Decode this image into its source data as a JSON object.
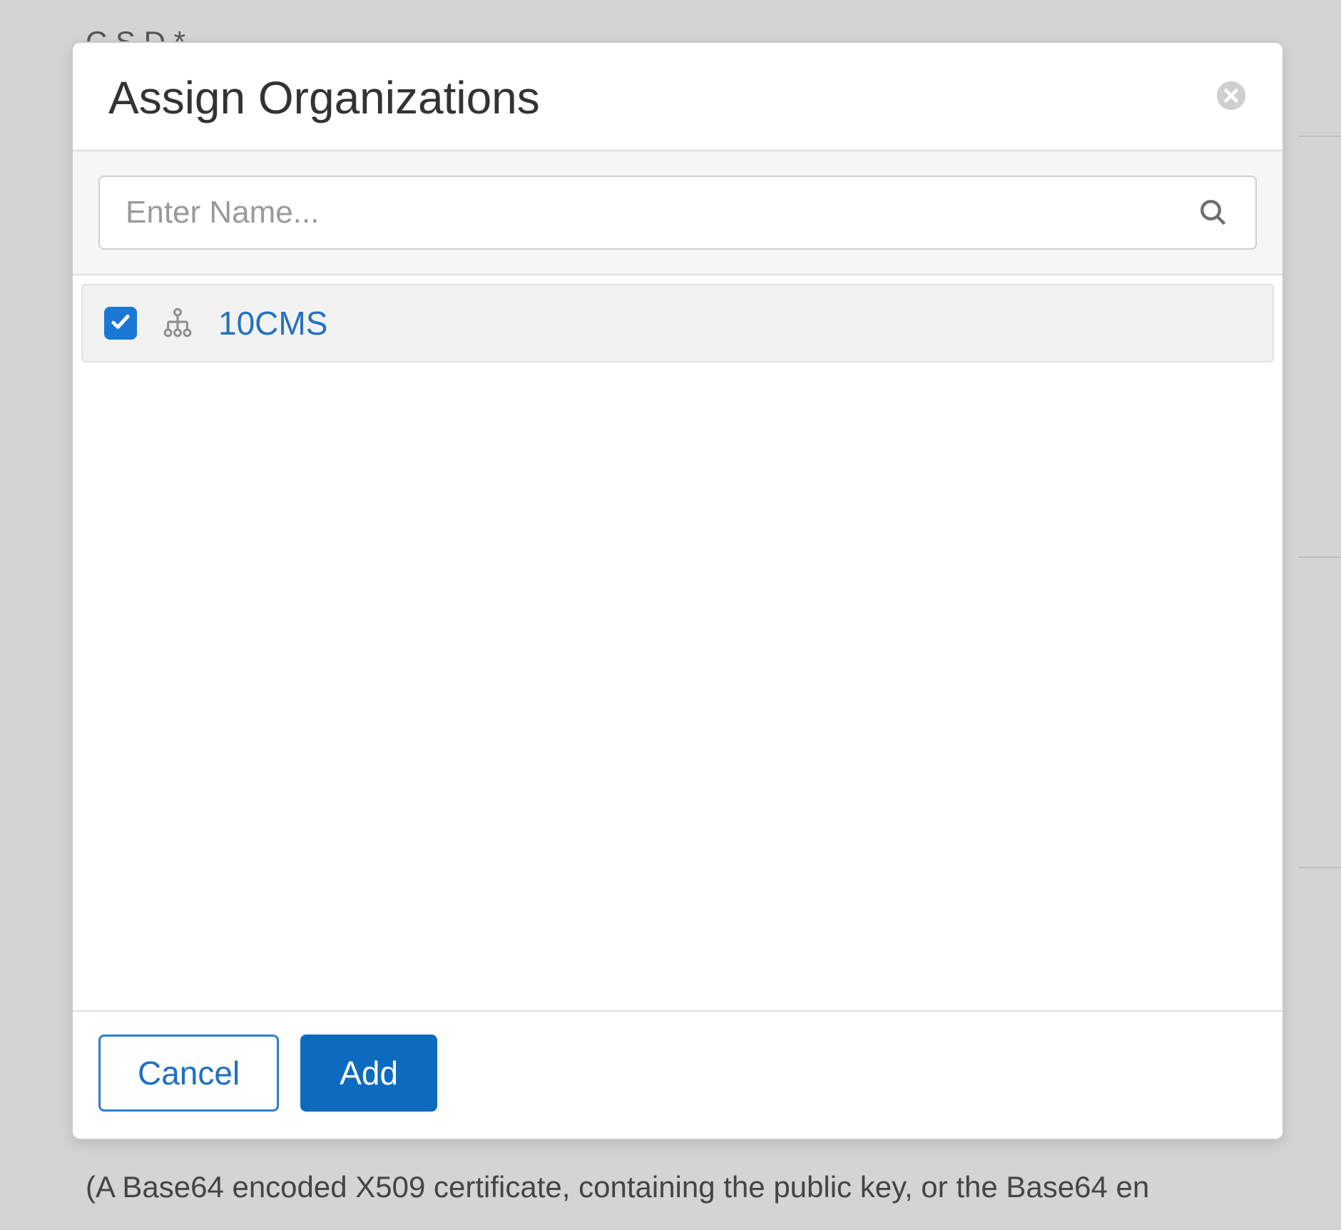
{
  "background": {
    "truncated_top_label": "C    S    D           *",
    "help_text": "(A Base64 encoded X509 certificate, containing the public key, or the Base64 en"
  },
  "modal": {
    "title": "Assign Organizations",
    "search": {
      "placeholder": "Enter Name...",
      "value": ""
    },
    "rows": [
      {
        "checked": true,
        "label": "10CMS"
      }
    ],
    "footer": {
      "cancel_label": "Cancel",
      "add_label": "Add"
    }
  }
}
